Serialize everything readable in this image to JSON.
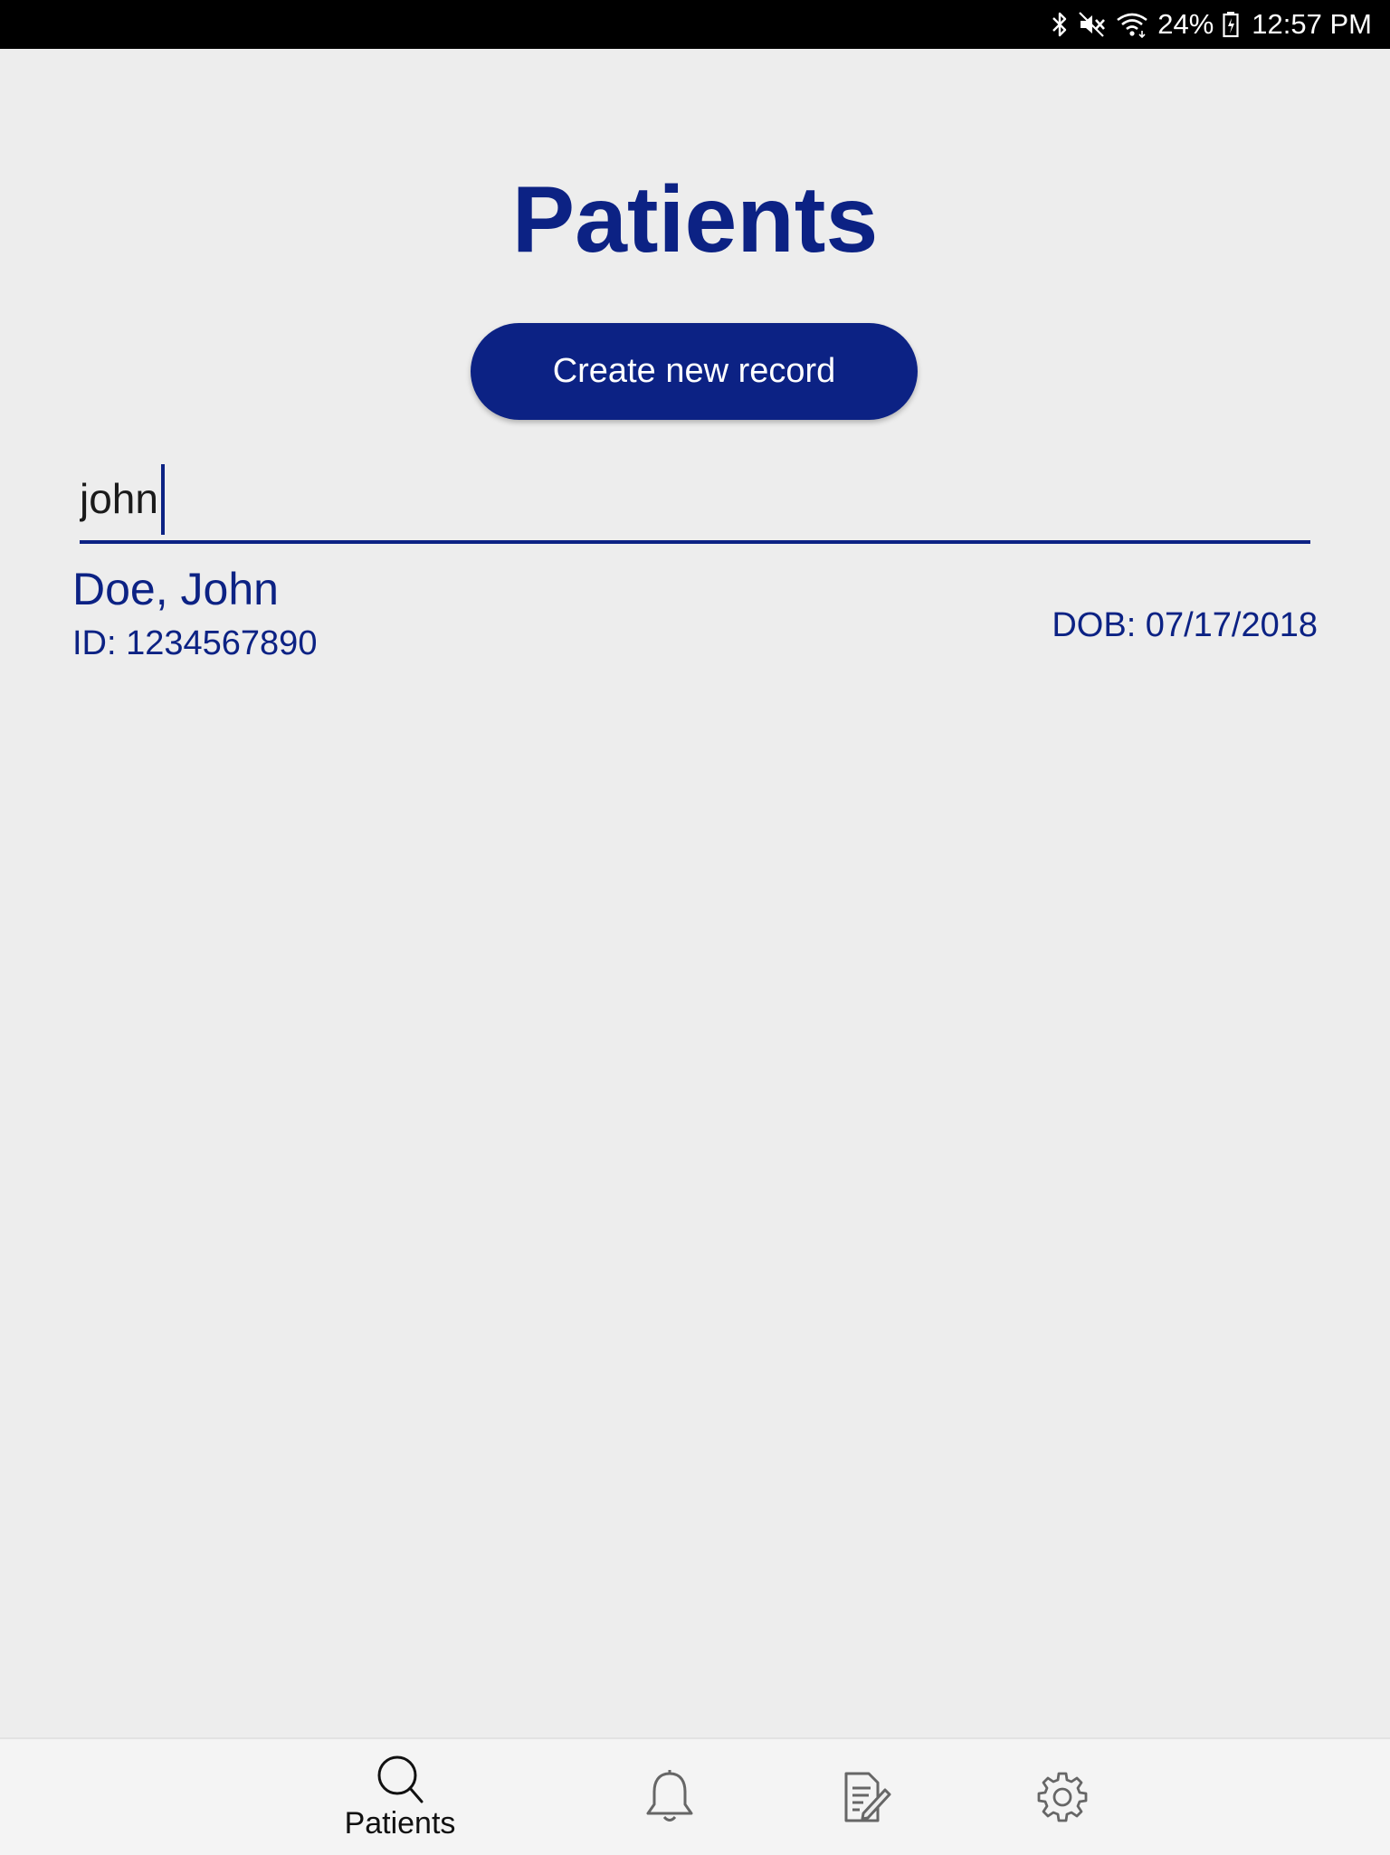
{
  "status_bar": {
    "battery": "24%",
    "time": "12:57 PM",
    "icons": [
      "bluetooth-icon",
      "mute-icon",
      "wifi-icon",
      "battery-icon"
    ]
  },
  "header": {
    "title": "Patients"
  },
  "actions": {
    "create_label": "Create new record"
  },
  "search": {
    "value": "john",
    "placeholder": ""
  },
  "results": [
    {
      "name": "Doe, John",
      "id": "ID: 1234567890",
      "dob": "DOB: 07/17/2018"
    }
  ],
  "bottom_nav": {
    "items": [
      {
        "label": "Patients",
        "icon": "search-icon",
        "active": true
      },
      {
        "label": "",
        "icon": "bell-icon"
      },
      {
        "label": "",
        "icon": "edit-document-icon"
      },
      {
        "label": "",
        "icon": "gear-icon"
      }
    ]
  },
  "colors": {
    "accent": "#0c2284",
    "background": "#ededed",
    "status_bar": "#000000",
    "nav_background": "#f4f4f4"
  }
}
